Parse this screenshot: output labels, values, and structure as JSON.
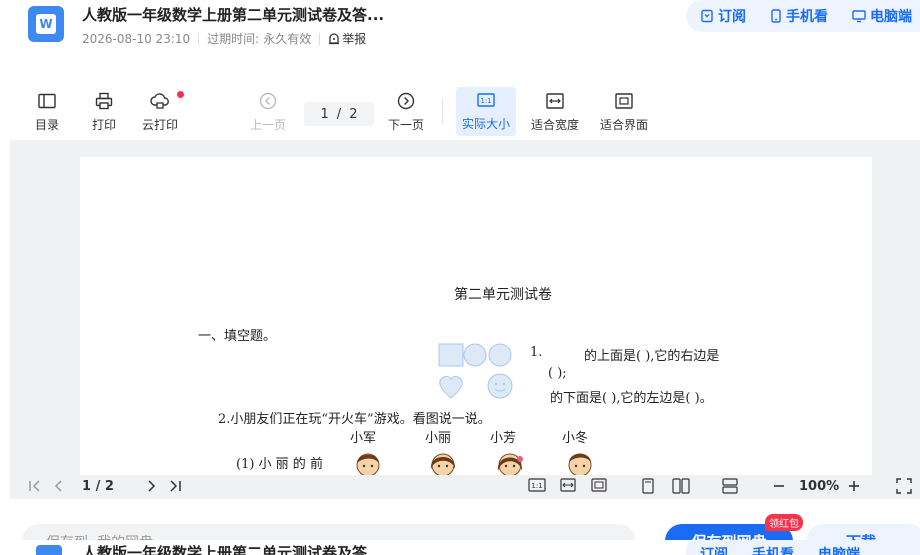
{
  "header": {
    "title": "人教版一年级数学上册第二单元测试卷及答...",
    "date": "2026-08-10 23:10",
    "expire_label": "过期时间:",
    "expire_value": "永久有效",
    "report": "举报",
    "actions": {
      "subscribe": "订阅",
      "mobile": "手机看",
      "pc": "电脑端"
    }
  },
  "toolbar": {
    "toc": "目录",
    "print": "打印",
    "cloud_print": "云打印",
    "prev": "上一页",
    "page_current": "1",
    "page_sep": "/",
    "page_total": "2",
    "next": "下一页",
    "actual_size": "实际大小",
    "fit_width": "适合宽度",
    "fit_screen": "适合界面"
  },
  "document": {
    "heading": "第二单元测试卷",
    "section1": "一、填空题。",
    "q1_num": "1.",
    "q1_line1": "的上面是(        ),它的右边是",
    "q1_line2": "(        );",
    "q1_line3": "的下面是(        ),它的左边是(        )。",
    "q2": "2.小朋友们正在玩“开火车”游戏。看图说一说。",
    "kids": [
      "小军",
      "小丽",
      "小芳",
      "小冬"
    ],
    "q2_sub": "(1) 小 丽 的 前"
  },
  "viewer": {
    "page_current": "1",
    "page_sep": "/",
    "page_total": "2",
    "zoom": "100%"
  },
  "bottom": {
    "save_to": "保存到: 我的网盘",
    "save_button": "保存到网盘",
    "badge": "领红包",
    "download": "下载"
  },
  "colors": {
    "accent": "#1a6cf5",
    "red": "#f5334a",
    "shape_fill": "#dce9f7"
  }
}
